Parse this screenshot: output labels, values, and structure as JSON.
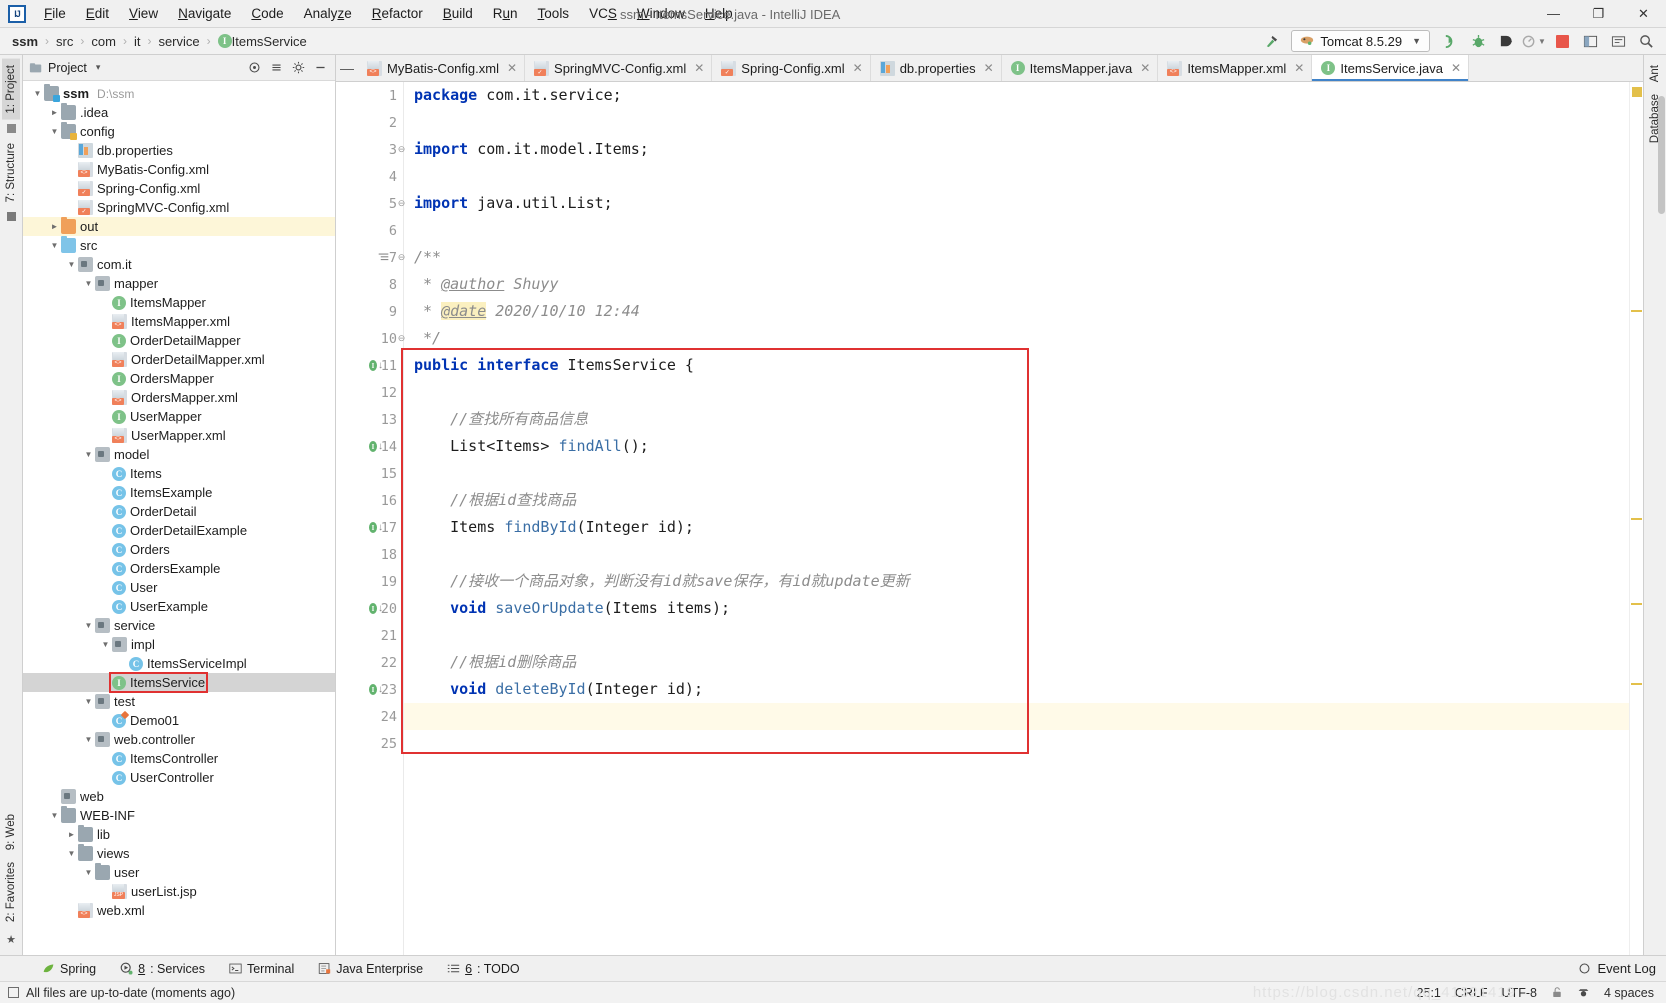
{
  "window": {
    "title": "ssm - ItemsService.java - IntelliJ IDEA",
    "minimize": "—",
    "maximize": "❐",
    "close": "✕"
  },
  "menu": [
    {
      "label": "File"
    },
    {
      "label": "Edit"
    },
    {
      "label": "View"
    },
    {
      "label": "Navigate"
    },
    {
      "label": "Code"
    },
    {
      "label": "Analyze"
    },
    {
      "label": "Refactor"
    },
    {
      "label": "Build"
    },
    {
      "label": "Run"
    },
    {
      "label": "Tools"
    },
    {
      "label": "VCS"
    },
    {
      "label": "Window"
    },
    {
      "label": "Help"
    }
  ],
  "breadcrumb": {
    "items": [
      {
        "label": "ssm",
        "icon": "none"
      },
      {
        "label": "src",
        "icon": "none"
      },
      {
        "label": "com",
        "icon": "none"
      },
      {
        "label": "it",
        "icon": "none"
      },
      {
        "label": "service",
        "icon": "none"
      },
      {
        "label": "ItemsService",
        "icon": "interface-icon"
      }
    ],
    "separator": "›"
  },
  "toolbar": {
    "build_hammer": "build-icon",
    "run_config": "Tomcat 8.5.29",
    "caret": "▼",
    "run_label": "run-icon",
    "debug_label": "debug-icon",
    "run_coverage_label": "run-with-coverage-icon",
    "profile_label": "profile-icon",
    "stop_label": "stop-icon",
    "layout_label": "layout-icon",
    "settings_label": "settings-icon",
    "search_label": "search-icon"
  },
  "rails": {
    "left_top": [
      {
        "label": "1: Project",
        "active": true
      },
      {
        "label": "7: Structure",
        "active": false
      }
    ],
    "left_bottom": [
      {
        "label": "9: Web"
      },
      {
        "label": "2: Favorites"
      }
    ],
    "right_top": [
      {
        "label": "Ant"
      },
      {
        "label": "Database"
      }
    ]
  },
  "project_panel": {
    "title": "Project",
    "caret": "▾",
    "actions": [
      "collapse-all-icon",
      "expand-icon",
      "settings-icon",
      "hide-icon"
    ],
    "tree": [
      {
        "depth": 0,
        "toggle": "open",
        "icon": "module-folder",
        "label": "ssm",
        "bold": true,
        "note": "D:\\ssm",
        "state": ""
      },
      {
        "depth": 1,
        "toggle": "closed",
        "icon": "folder",
        "label": ".idea",
        "state": ""
      },
      {
        "depth": 1,
        "toggle": "open",
        "icon": "resource-folder",
        "label": "config",
        "state": ""
      },
      {
        "depth": 2,
        "toggle": "none",
        "icon": "properties",
        "label": "db.properties",
        "state": ""
      },
      {
        "depth": 2,
        "toggle": "none",
        "icon": "xml",
        "label": "MyBatis-Config.xml",
        "state": ""
      },
      {
        "depth": 2,
        "toggle": "none",
        "icon": "xml-spring",
        "label": "Spring-Config.xml",
        "state": ""
      },
      {
        "depth": 2,
        "toggle": "none",
        "icon": "xml-spring",
        "label": "SpringMVC-Config.xml",
        "state": ""
      },
      {
        "depth": 1,
        "toggle": "closed",
        "icon": "folder-orange",
        "label": "out",
        "state": "hl"
      },
      {
        "depth": 1,
        "toggle": "open",
        "icon": "folder-src",
        "label": "src",
        "state": ""
      },
      {
        "depth": 2,
        "toggle": "open",
        "icon": "package",
        "label": "com.it",
        "state": ""
      },
      {
        "depth": 3,
        "toggle": "open",
        "icon": "package",
        "label": "mapper",
        "state": ""
      },
      {
        "depth": 4,
        "toggle": "none",
        "icon": "interface",
        "label": "ItemsMapper",
        "state": ""
      },
      {
        "depth": 4,
        "toggle": "none",
        "icon": "xml",
        "label": "ItemsMapper.xml",
        "state": ""
      },
      {
        "depth": 4,
        "toggle": "none",
        "icon": "interface",
        "label": "OrderDetailMapper",
        "state": ""
      },
      {
        "depth": 4,
        "toggle": "none",
        "icon": "xml",
        "label": "OrderDetailMapper.xml",
        "state": ""
      },
      {
        "depth": 4,
        "toggle": "none",
        "icon": "interface",
        "label": "OrdersMapper",
        "state": ""
      },
      {
        "depth": 4,
        "toggle": "none",
        "icon": "xml",
        "label": "OrdersMapper.xml",
        "state": ""
      },
      {
        "depth": 4,
        "toggle": "none",
        "icon": "interface",
        "label": "UserMapper",
        "state": ""
      },
      {
        "depth": 4,
        "toggle": "none",
        "icon": "xml",
        "label": "UserMapper.xml",
        "state": ""
      },
      {
        "depth": 3,
        "toggle": "open",
        "icon": "package",
        "label": "model",
        "state": ""
      },
      {
        "depth": 4,
        "toggle": "none",
        "icon": "class",
        "label": "Items",
        "state": ""
      },
      {
        "depth": 4,
        "toggle": "none",
        "icon": "class",
        "label": "ItemsExample",
        "state": ""
      },
      {
        "depth": 4,
        "toggle": "none",
        "icon": "class",
        "label": "OrderDetail",
        "state": ""
      },
      {
        "depth": 4,
        "toggle": "none",
        "icon": "class",
        "label": "OrderDetailExample",
        "state": ""
      },
      {
        "depth": 4,
        "toggle": "none",
        "icon": "class",
        "label": "Orders",
        "state": ""
      },
      {
        "depth": 4,
        "toggle": "none",
        "icon": "class",
        "label": "OrdersExample",
        "state": ""
      },
      {
        "depth": 4,
        "toggle": "none",
        "icon": "class",
        "label": "User",
        "state": ""
      },
      {
        "depth": 4,
        "toggle": "none",
        "icon": "class",
        "label": "UserExample",
        "state": ""
      },
      {
        "depth": 3,
        "toggle": "open",
        "icon": "package",
        "label": "service",
        "state": ""
      },
      {
        "depth": 4,
        "toggle": "open",
        "icon": "package",
        "label": "impl",
        "state": ""
      },
      {
        "depth": 5,
        "toggle": "none",
        "icon": "class",
        "label": "ItemsServiceImpl",
        "state": ""
      },
      {
        "depth": 4,
        "toggle": "none",
        "icon": "interface",
        "label": "ItemsService",
        "state": "sel boxed"
      },
      {
        "depth": 3,
        "toggle": "open",
        "icon": "package",
        "label": "test",
        "state": ""
      },
      {
        "depth": 4,
        "toggle": "none",
        "icon": "class-test",
        "label": "Demo01",
        "state": ""
      },
      {
        "depth": 3,
        "toggle": "open",
        "icon": "package",
        "label": "web.controller",
        "state": ""
      },
      {
        "depth": 4,
        "toggle": "none",
        "icon": "class",
        "label": "ItemsController",
        "state": ""
      },
      {
        "depth": 4,
        "toggle": "none",
        "icon": "class",
        "label": "UserController",
        "state": ""
      },
      {
        "depth": 1,
        "toggle": "none",
        "icon": "package",
        "label": "web",
        "state": ""
      },
      {
        "depth": 1,
        "toggle": "open",
        "icon": "folder",
        "label": "WEB-INF",
        "state": ""
      },
      {
        "depth": 2,
        "toggle": "closed",
        "icon": "folder",
        "label": "lib",
        "state": ""
      },
      {
        "depth": 2,
        "toggle": "open",
        "icon": "folder",
        "label": "views",
        "state": ""
      },
      {
        "depth": 3,
        "toggle": "open",
        "icon": "folder",
        "label": "user",
        "state": ""
      },
      {
        "depth": 4,
        "toggle": "none",
        "icon": "jsp",
        "label": "userList.jsp",
        "state": ""
      },
      {
        "depth": 2,
        "toggle": "none",
        "icon": "xml",
        "label": "web.xml",
        "state": ""
      }
    ]
  },
  "editor": {
    "collapse_icon": "—",
    "tabs": [
      {
        "label": "MyBatis-Config.xml",
        "icon": "xml-icon",
        "active": false,
        "close": "✕"
      },
      {
        "label": "SpringMVC-Config.xml",
        "icon": "xml-spring-icon",
        "active": false,
        "close": "✕"
      },
      {
        "label": "Spring-Config.xml",
        "icon": "xml-spring-icon",
        "active": false,
        "close": "✕"
      },
      {
        "label": "db.properties",
        "icon": "properties-icon",
        "active": false,
        "close": "✕"
      },
      {
        "label": "ItemsMapper.java",
        "icon": "interface-icon",
        "active": false,
        "close": "✕"
      },
      {
        "label": "ItemsMapper.xml",
        "icon": "xml-icon",
        "active": false,
        "close": "✕"
      },
      {
        "label": "ItemsService.java",
        "icon": "interface-icon",
        "active": true,
        "close": "✕"
      }
    ],
    "line_numbers": [
      "1",
      "2",
      "3",
      "4",
      "5",
      "6",
      "7",
      "8",
      "9",
      "10",
      "11",
      "12",
      "13",
      "14",
      "15",
      "16",
      "17",
      "18",
      "19",
      "20",
      "21",
      "22",
      "23",
      "24",
      "25"
    ],
    "code_lines": [
      {
        "n": 1,
        "html": "kw:package| pl:com.it.service;"
      },
      {
        "n": 2,
        "html": ""
      },
      {
        "n": 3,
        "html": "kw:import| pl:com.it.model.Items;"
      },
      {
        "n": 4,
        "html": ""
      },
      {
        "n": 5,
        "html": "kw:import| pl:java.util.List;"
      },
      {
        "n": 6,
        "html": ""
      },
      {
        "n": 7,
        "html": "cmt:/**"
      },
      {
        "n": 8,
        "html": "cmt: * @author Shuyy"
      },
      {
        "n": 9,
        "html": "cmt: * @date 2020/10/10 12:44"
      },
      {
        "n": 10,
        "html": "cmt: */"
      },
      {
        "n": 11,
        "html": "kw:public interface| pl:ItemsService {"
      },
      {
        "n": 12,
        "html": ""
      },
      {
        "n": 13,
        "html": "cmt:    //查找所有商品信息"
      },
      {
        "n": 14,
        "html": "pl:    List<Items> |mth:findAll|pl:();"
      },
      {
        "n": 15,
        "html": ""
      },
      {
        "n": 16,
        "html": "cmt:    //根据id查找商品"
      },
      {
        "n": 17,
        "html": "pl:    Items |mth:findById|pl:(Integer id);"
      },
      {
        "n": 18,
        "html": ""
      },
      {
        "n": 19,
        "html": "cmt:    //接收一个商品对象，判断没有id就save保存，有id就update更新"
      },
      {
        "n": 20,
        "html": "kw:    void |mth:saveOrUpdate|pl:(Items items);"
      },
      {
        "n": 21,
        "html": ""
      },
      {
        "n": 22,
        "html": "cmt:    //根据id删除商品"
      },
      {
        "n": 23,
        "html": "kw:    void |mth:deleteById|pl:(Integer id);"
      },
      {
        "n": 24,
        "html": "pl:}"
      },
      {
        "n": 25,
        "html": ""
      }
    ],
    "code_text": {
      "l1_kw": "package",
      "l1_rest": " com.it.service;",
      "l3_kw": "import",
      "l3_rest": " com.it.model.Items;",
      "l5_kw": "import",
      "l5_rest": " java.util.List;",
      "l7": "/**",
      "l8_star": " * ",
      "l8_tag": "@author",
      "l8_val": " Shuyy",
      "l9_star": " * ",
      "l9_tag": "@date",
      "l9_val": " 2020/10/10 12:44",
      "l10": " */",
      "l11_kw": "public interface",
      "l11_rest": " ItemsService {",
      "l13": "    //查找所有商品信息",
      "l14_type": "    List<Items> ",
      "l14_m": "findAll",
      "l14_rest": "();",
      "l16": "    //根据id查找商品",
      "l17_type": "    Items ",
      "l17_m": "findById",
      "l17_rest": "(Integer id);",
      "l19": "    //接收一个商品对象，判断没有id就save保存，有id就update更新",
      "l20_kw": "    void ",
      "l20_m": "saveOrUpdate",
      "l20_rest": "(Items items);",
      "l22": "    //根据id删除商品",
      "l23_kw": "    void ",
      "l23_m": "deleteById",
      "l23_rest": "(Integer id);",
      "l24": "}"
    },
    "gutter_markers": [
      {
        "line": 11,
        "type": "implemented-icon"
      },
      {
        "line": 14,
        "type": "implemented-icon"
      },
      {
        "line": 17,
        "type": "implemented-icon"
      },
      {
        "line": 20,
        "type": "implemented-icon"
      },
      {
        "line": 23,
        "type": "implemented-icon"
      }
    ]
  },
  "tool_windows": [
    {
      "label": "Spring",
      "icon": "spring-leaf-icon",
      "mnemonic": ""
    },
    {
      "label": ": Services",
      "icon": "services-icon",
      "mnemonic": "8"
    },
    {
      "label": "Terminal",
      "icon": "terminal-icon",
      "mnemonic": ""
    },
    {
      "label": "Java Enterprise",
      "icon": "java-enterprise-icon",
      "mnemonic": ""
    },
    {
      "label": ": TODO",
      "icon": "todo-icon",
      "mnemonic": "6"
    }
  ],
  "event_log": {
    "label": "Event Log",
    "icon": "event-log-icon"
  },
  "status_bar": {
    "message": "All files are up-to-date (moments ago)",
    "caret_position": "25:1",
    "line_separator": "CRLF",
    "encoding": "UTF-8",
    "lock_icon": "unlocked-icon",
    "inspection_icon": "hector-icon",
    "indent": "4 spaces",
    "watermark": "https://blog.csdn.net/qq_41321419"
  },
  "colors": {
    "accent_blue": "#4083c9",
    "keyword_blue": "#0033b3",
    "method_blue": "#3a6ea5",
    "comment_gray": "#8c8c8c",
    "red_box": "#e03131",
    "interface_green": "#7ec288",
    "class_blue": "#76c3e8",
    "highlight_yellow": "#fdf6d8"
  }
}
